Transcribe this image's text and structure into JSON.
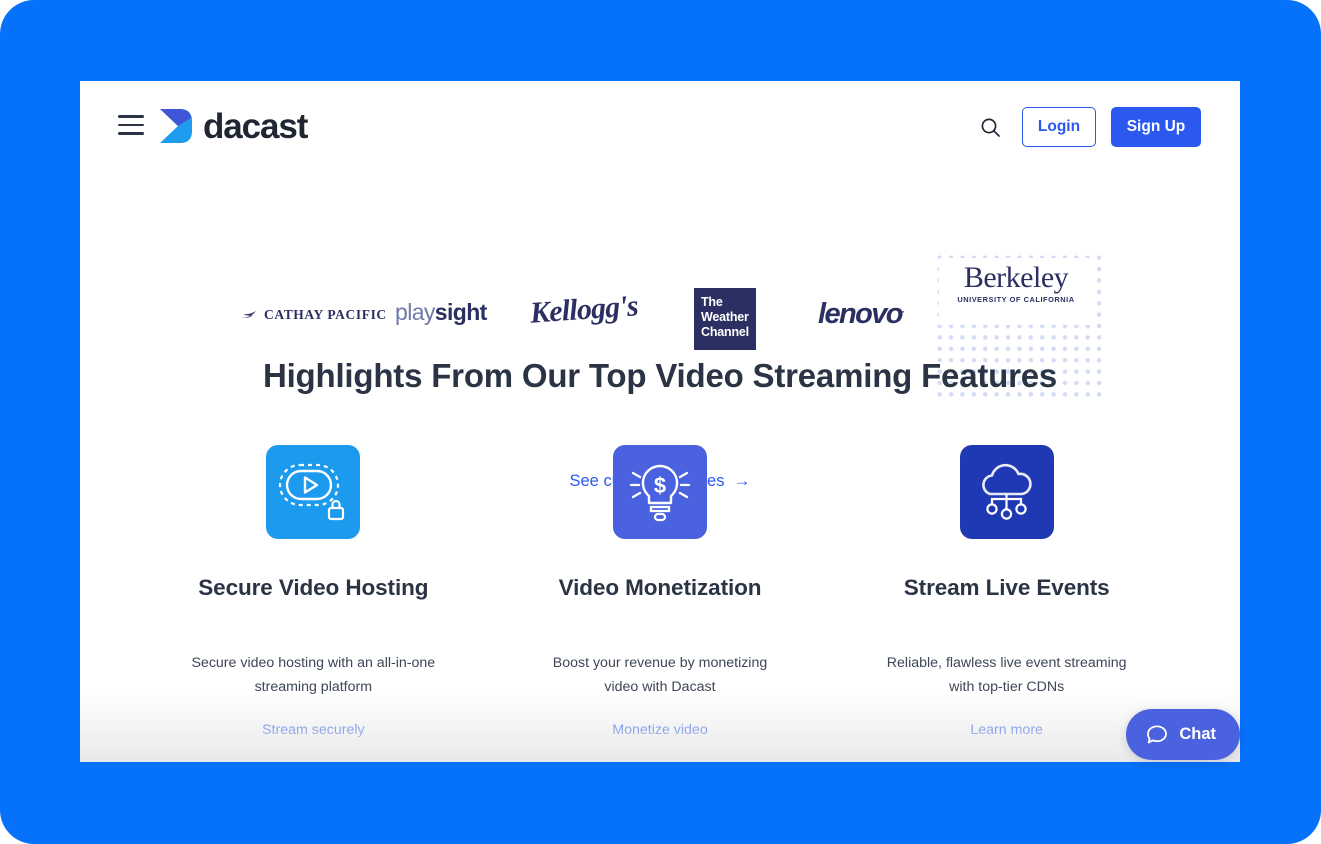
{
  "theme": {
    "page_bg": "#0671fb",
    "card_bg": "#ffffff",
    "brand_blue": "#2b59f0",
    "heading_color": "#2b3445",
    "logo_navy": "#2c2f62"
  },
  "header": {
    "menu_icon": "hamburger-icon",
    "logo_text": "dacast",
    "logo_mark_icon": "dacast-arrow-logo",
    "search_icon": "search-icon",
    "login_label": "Login",
    "signup_label": "Sign Up"
  },
  "logo_strip": {
    "logos": [
      {
        "name": "Cathay Pacific",
        "text": "CATHAY PACIFIC",
        "icon": "cathay-brushwing-icon"
      },
      {
        "name": "PlaySight",
        "text_light": "play",
        "text_bold": "sight"
      },
      {
        "name": "Kellogg's",
        "text": "Kellogg's"
      },
      {
        "name": "The Weather Channel",
        "line1": "The",
        "line2": "Weather",
        "line3": "Channel"
      },
      {
        "name": "Lenovo",
        "text": "lenovo",
        "mark": "."
      },
      {
        "name": "UC Berkeley",
        "text": "Berkeley",
        "subtext": "UNIVERSITY OF CALIFORNIA"
      }
    ],
    "stories_link": "See customer stories",
    "stories_arrow": "→"
  },
  "section": {
    "title": "Highlights From Our Top Video Streaming Features"
  },
  "features": [
    {
      "icon_name": "secure-video-play-lock-icon",
      "icon_bg": "#1c9aed",
      "title": "Secure Video Hosting",
      "description": "Secure video hosting with an all-in-one streaming platform",
      "cta": "Stream securely"
    },
    {
      "icon_name": "lightbulb-dollar-icon",
      "icon_bg": "#4a62e0",
      "title": "Video Monetization",
      "description": "Boost your revenue by monetizing video with Dacast",
      "cta": "Monetize video"
    },
    {
      "icon_name": "cloud-cdn-network-icon",
      "icon_bg": "#1f39b5",
      "title": "Stream Live Events",
      "description": "Reliable, flawless live event streaming with top-tier CDNs",
      "cta": "Learn more"
    }
  ],
  "chat_widget": {
    "label": "Chat",
    "icon_name": "chat-bubble-icon",
    "bg": "#4a62e0"
  }
}
